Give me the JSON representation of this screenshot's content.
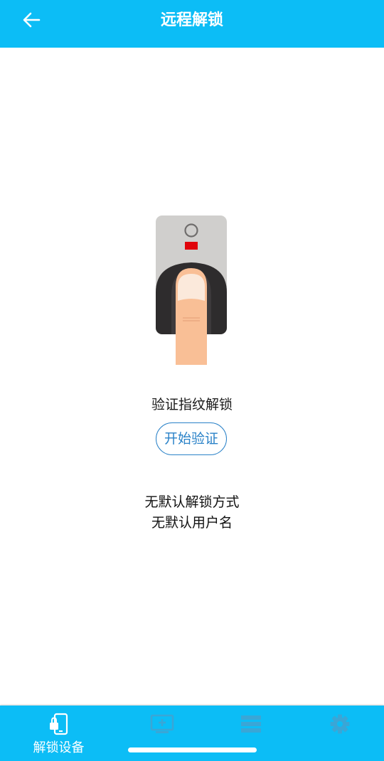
{
  "header": {
    "title": "远程解锁",
    "back_icon": "arrow-left-icon",
    "background_color": "#0cbdf6"
  },
  "main": {
    "illustration_icon": "fingerprint-scanner-icon",
    "verify_label": "验证指纹解锁",
    "start_button_label": "开始验证",
    "default_unlock_method": "无默认解锁方式",
    "default_username": "无默认用户名"
  },
  "bottom_nav": {
    "items": [
      {
        "label": "解锁设备",
        "icon": "phone-lock-icon",
        "active": true
      },
      {
        "label": "",
        "icon": "add-device-icon",
        "active": false
      },
      {
        "label": "",
        "icon": "list-icon",
        "active": false
      },
      {
        "label": "",
        "icon": "gear-icon",
        "active": false
      }
    ]
  },
  "colors": {
    "accent": "#0cbdf6",
    "button_border": "#2a82c8",
    "inactive_icon": "#3aa6d6"
  }
}
